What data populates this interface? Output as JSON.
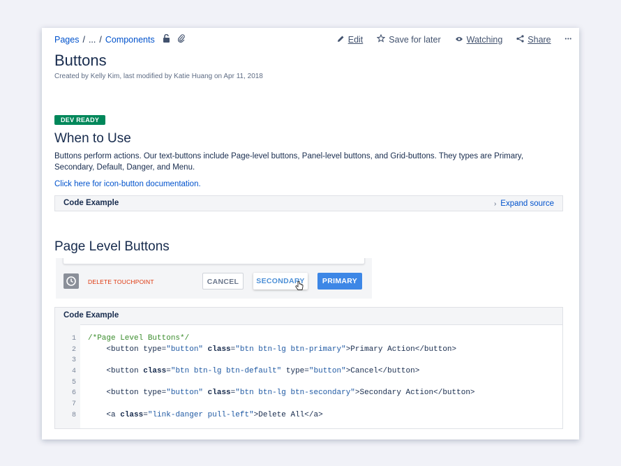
{
  "breadcrumb": {
    "root": "Pages",
    "sep1": "/",
    "ellipsis": "...",
    "sep2": "/",
    "current": "Components"
  },
  "actions": {
    "edit": "Edit",
    "save": "Save for later",
    "watching": "Watching",
    "share": "Share",
    "more": "•••"
  },
  "page": {
    "title": "Buttons",
    "meta": "Created by Kelly Kim, last modified by Katie Huang on Apr 11, 2018",
    "badge": "DEV READY",
    "when_heading": "When to Use",
    "description": "Buttons perform actions. Our text-buttons include Page-level buttons, Panel-level buttons, and Grid-buttons. They types are Primary, Secondary, Default, Danger, and Menu.",
    "doc_link": "Click here for icon-button documentation.",
    "code_example_label": "Code Example",
    "expand_source": "Expand source",
    "page_level_heading": "Page Level Buttons"
  },
  "demo": {
    "delete_label": "DELETE TOUCHPOINT",
    "cancel": "CANCEL",
    "secondary": "SECONDARY",
    "primary": "PRIMARY"
  },
  "code": {
    "label": "Code Example",
    "line_numbers": [
      "1",
      "2",
      "3",
      "4",
      "5",
      "6",
      "7",
      "8"
    ]
  },
  "colors": {
    "accent": "#0052cc",
    "badge": "#00875a",
    "primary_button": "#3d87e6",
    "danger": "#de350b"
  }
}
